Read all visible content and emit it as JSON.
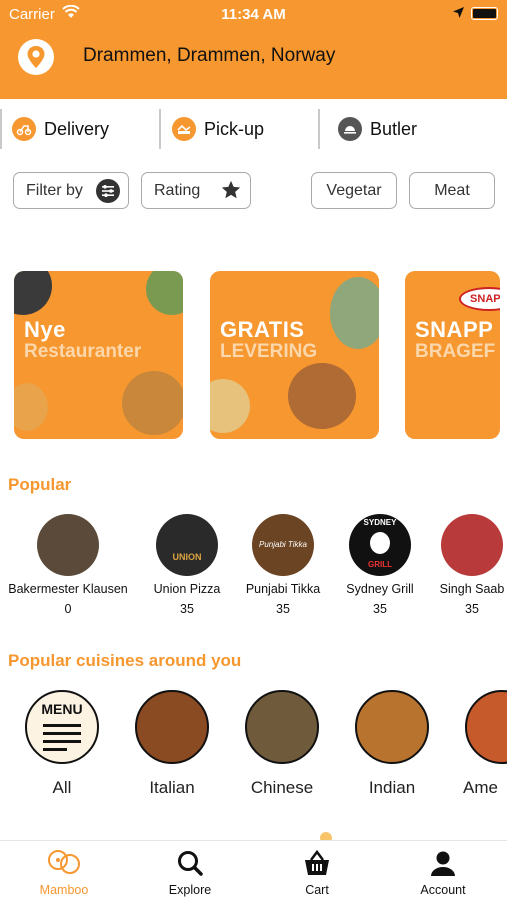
{
  "status_bar": {
    "carrier": "Carrier",
    "time": "11:34 AM"
  },
  "header": {
    "location": "Drammen, Drammen, Norway"
  },
  "modes": [
    {
      "label": "Delivery",
      "icon": "scooter-icon"
    },
    {
      "label": "Pick-up",
      "icon": "pickup-icon"
    },
    {
      "label": "Butler",
      "icon": "butler-icon"
    }
  ],
  "filters": {
    "filter_by": "Filter by",
    "rating": "Rating",
    "vegetar": "Vegetar",
    "meat": "Meat"
  },
  "banners": [
    {
      "line1": "Nye",
      "line2": "Restauranter"
    },
    {
      "line1": "GRATIS",
      "line2": "LEVERING"
    },
    {
      "line1": "SNAPP",
      "line2": "BRAGEF",
      "badge": "SNAPP"
    }
  ],
  "popular": {
    "title": "Popular",
    "items": [
      {
        "name": "Bakermester Klausen",
        "count": "0"
      },
      {
        "name": "Union Pizza",
        "count": "35"
      },
      {
        "name": "Punjabi Tikka",
        "count": "35"
      },
      {
        "name": "Sydney Grill",
        "count": "35"
      },
      {
        "name": "Singh Saab",
        "count": "35"
      }
    ],
    "logo_texts": {
      "union": "UNION",
      "punjabi": "Punjabi Tikka",
      "sydney_top": "SYDNEY",
      "sydney_bottom": "GRILL"
    }
  },
  "cuisines": {
    "title": "Popular cuisines around you",
    "menu_text": "MENU",
    "items": [
      {
        "label": "All"
      },
      {
        "label": "Italian"
      },
      {
        "label": "Chinese"
      },
      {
        "label": "Indian"
      },
      {
        "label": "Ame"
      }
    ]
  },
  "tabs": [
    {
      "label": "Mamboo",
      "icon": "mamboo-icon",
      "active": true
    },
    {
      "label": "Explore",
      "icon": "search-icon"
    },
    {
      "label": "Cart",
      "icon": "basket-icon"
    },
    {
      "label": "Account",
      "icon": "user-icon"
    }
  ],
  "colors": {
    "brand": "#F7972F",
    "text": "#111111"
  }
}
